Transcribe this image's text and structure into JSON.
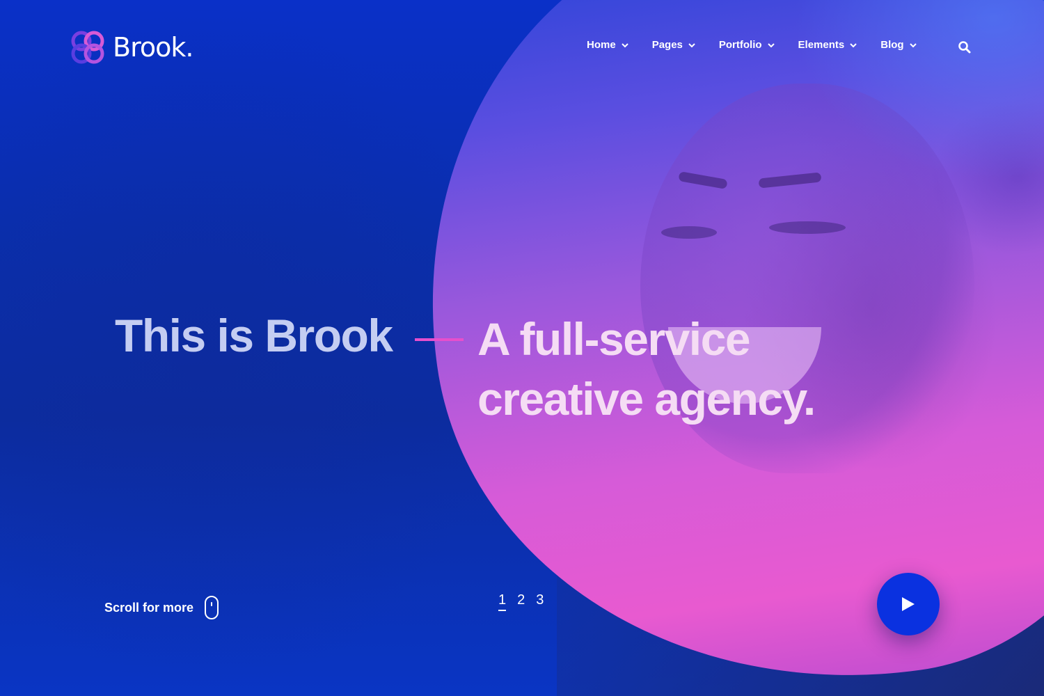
{
  "header": {
    "brand": "Brook.",
    "nav": [
      {
        "label": "Home",
        "icon": "chevron-down-icon"
      },
      {
        "label": "Pages",
        "icon": "chevron-down-icon"
      },
      {
        "label": "Portfolio",
        "icon": "chevron-down-icon"
      },
      {
        "label": "Elements",
        "icon": "chevron-down-icon"
      },
      {
        "label": "Blog",
        "icon": "chevron-down-icon"
      }
    ],
    "search_icon": "search-icon"
  },
  "hero": {
    "left_title": "This is Brook",
    "right_line1": "A full-service",
    "right_line2": "creative agency."
  },
  "footer": {
    "scroll_label": "Scroll for more",
    "slides": [
      "1",
      "2",
      "3"
    ],
    "active_slide": "1",
    "play_icon": "play-icon"
  },
  "colors": {
    "background": "#0a2eab",
    "accent_pink": "#e64fcc",
    "play_button": "#0a31e0",
    "text_white": "#ffffff"
  }
}
